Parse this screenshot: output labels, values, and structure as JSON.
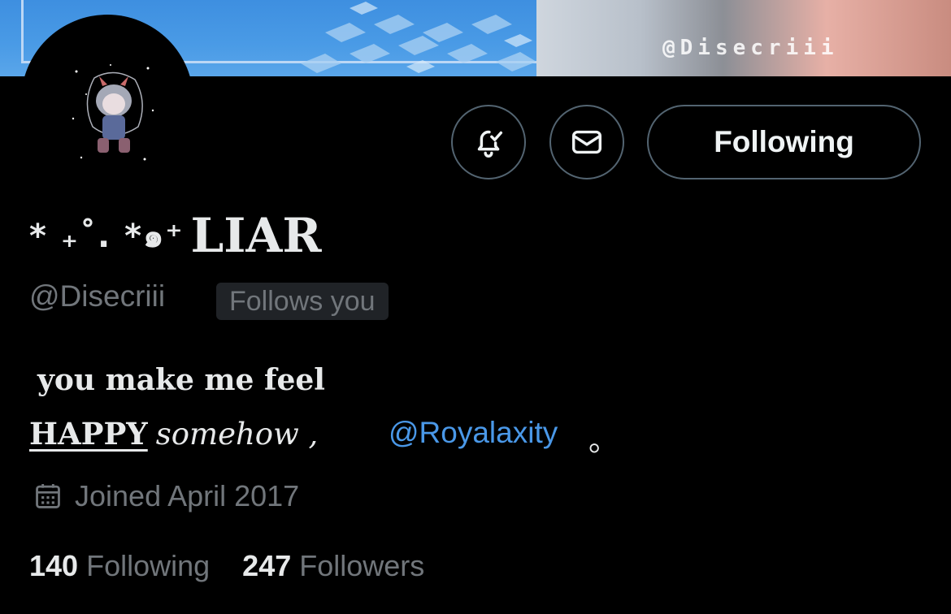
{
  "banner": {
    "watermark": "@Disecriii"
  },
  "profile": {
    "display_name_deco": "* ₊˚. *๑⁺",
    "display_name": "LIAR",
    "handle": "@Disecriii",
    "follows_you_label": "Follows you"
  },
  "actions": {
    "notify_icon": "bell-with-check-icon",
    "message_icon": "envelope-icon",
    "follow_label": "Following"
  },
  "bio": {
    "line1": "you make me feel",
    "happy": "HAPPY",
    "somehow": "somehow ,",
    "mention": "@Royalaxity",
    "end": "。"
  },
  "joined": {
    "icon": "calendar-icon",
    "text": "Joined April 2017"
  },
  "stats": {
    "following_count": "140",
    "following_label": "Following",
    "followers_count": "247",
    "followers_label": "Followers"
  },
  "colors": {
    "background": "#000000",
    "text_primary": "#e7e9ea",
    "text_secondary": "#71767b",
    "link": "#4a98e8",
    "border": "#536471"
  }
}
